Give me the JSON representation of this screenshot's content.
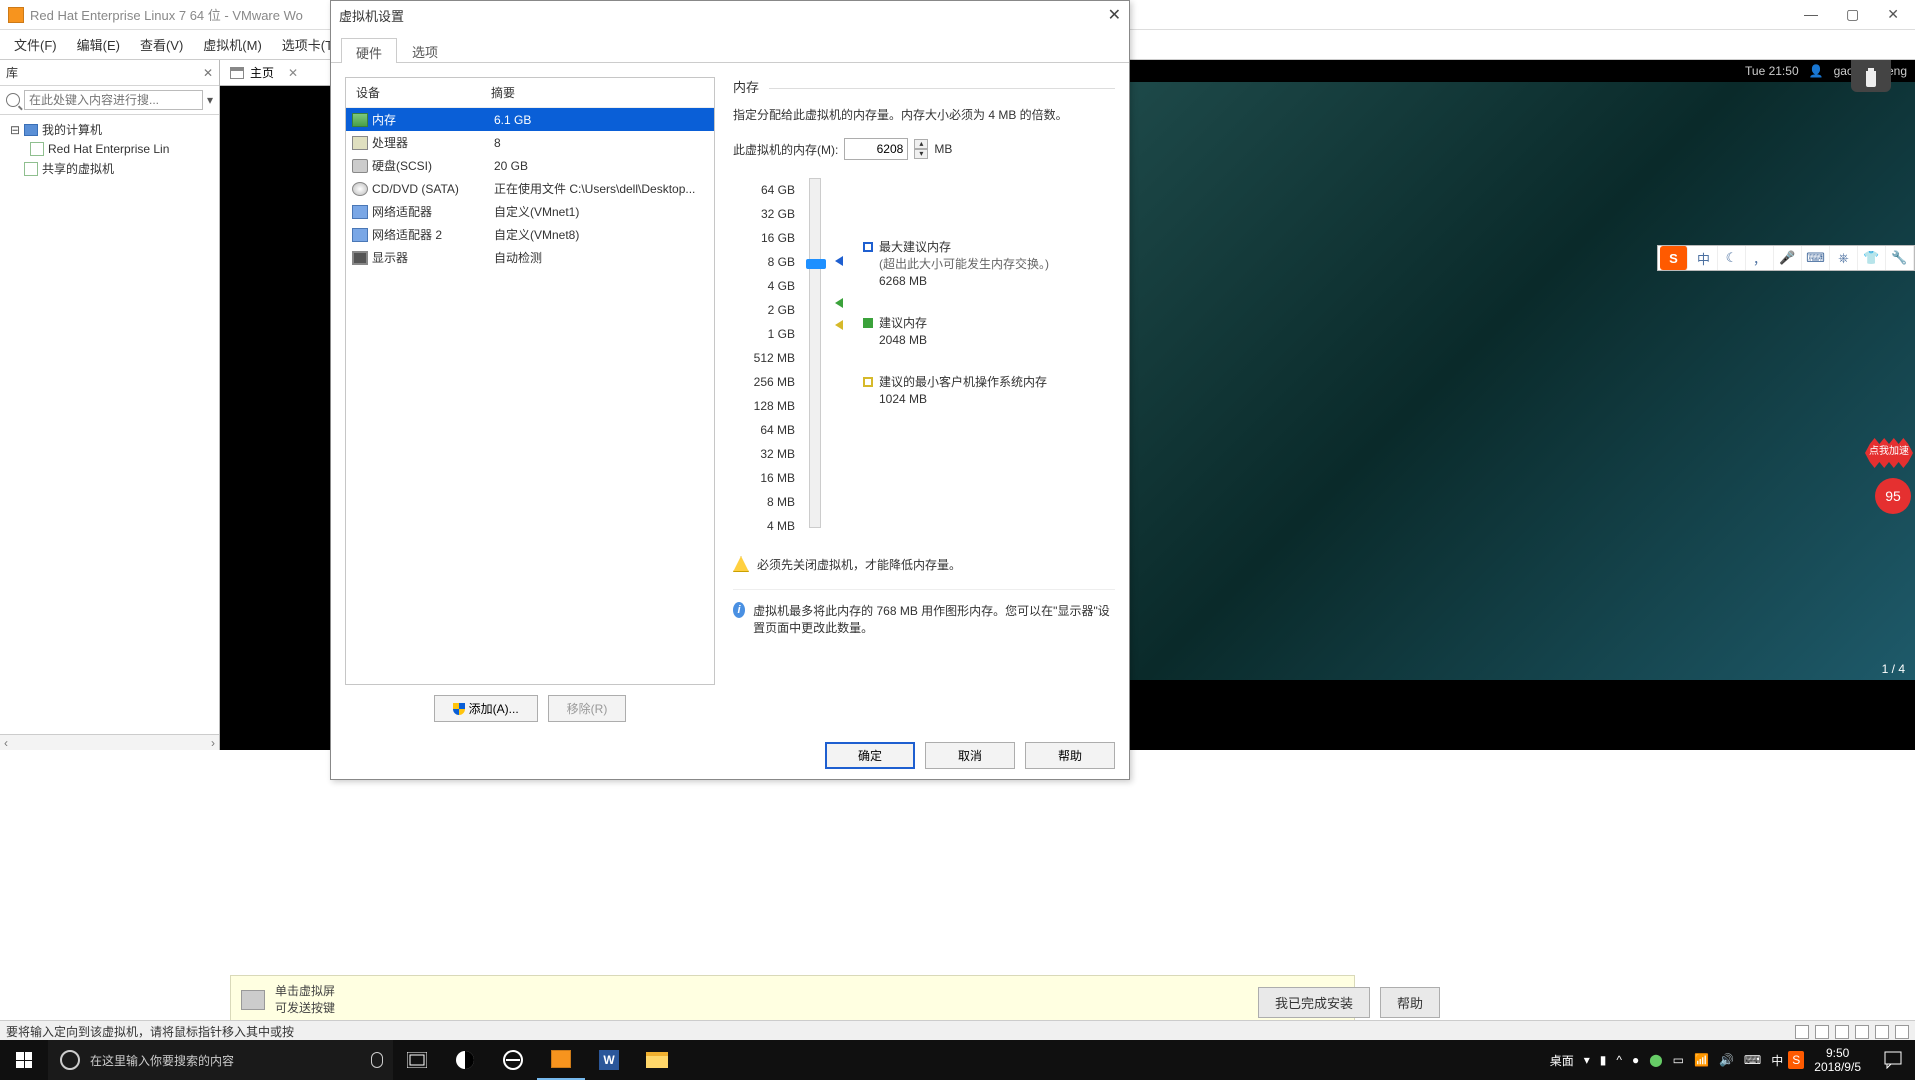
{
  "window": {
    "title": "Red Hat Enterprise Linux 7 64 位 - VMware Wo"
  },
  "menu": [
    "文件(F)",
    "编辑(E)",
    "查看(V)",
    "虚拟机(M)",
    "选项卡(T)"
  ],
  "library": {
    "title": "库",
    "search_placeholder": "在此处键入内容进行搜...",
    "tree": {
      "root": "我的计算机",
      "child": "Red Hat Enterprise Lin",
      "shared": "共享的虚拟机"
    }
  },
  "home_tab": "主页",
  "modal": {
    "title": "虚拟机设置",
    "tabs": [
      "硬件",
      "选项"
    ],
    "cols": [
      "设备",
      "摘要"
    ],
    "rows": [
      {
        "name": "内存",
        "summary": "6.1 GB",
        "icon": "mem",
        "sel": true
      },
      {
        "name": "处理器",
        "summary": "8",
        "icon": "cpu"
      },
      {
        "name": "硬盘(SCSI)",
        "summary": "20 GB",
        "icon": "hdd"
      },
      {
        "name": "CD/DVD (SATA)",
        "summary": "正在使用文件 C:\\Users\\dell\\Desktop...",
        "icon": "cd"
      },
      {
        "name": "网络适配器",
        "summary": "自定义(VMnet1)",
        "icon": "net"
      },
      {
        "name": "网络适配器 2",
        "summary": "自定义(VMnet8)",
        "icon": "net"
      },
      {
        "name": "显示器",
        "summary": "自动检测",
        "icon": "disp"
      }
    ],
    "add_btn": "添加(A)...",
    "remove_btn": "移除(R)",
    "group": "内存",
    "desc": "指定分配给此虚拟机的内存量。内存大小必须为 4 MB 的倍数。",
    "mem_label": "此虚拟机的内存(M):",
    "mem_value": "6208",
    "mem_unit": "MB",
    "ticks": [
      "64 GB",
      "32 GB",
      "16 GB",
      "8 GB",
      "4 GB",
      "2 GB",
      "1 GB",
      "512 MB",
      "256 MB",
      "128 MB",
      "64 MB",
      "32 MB",
      "16 MB",
      "8 MB",
      "4 MB"
    ],
    "legend_max": {
      "t": "最大建议内存",
      "sub": "(超出此大小可能发生内存交换。)",
      "v": "6268 MB"
    },
    "legend_rec": {
      "t": "建议内存",
      "v": "2048 MB"
    },
    "legend_min": {
      "t": "建议的最小客户机操作系统内存",
      "v": "1024 MB"
    },
    "warn": "必须先关闭虚拟机，才能降低内存量。",
    "info": "虚拟机最多将此内存的 768 MB 用作图形内存。您可以在\"显示器\"设置页面中更改此数量。",
    "ok": "确定",
    "cancel": "取消",
    "help": "帮助"
  },
  "tip": {
    "l1": "单击虚拟屏",
    "l2": "可发送按键"
  },
  "footer_btns": {
    "done": "我已完成安装",
    "help": "帮助"
  },
  "status": "要将输入定向到该虚拟机，请将鼠标指针移入其中或按",
  "vm": {
    "time": "Tue 21:50",
    "user": "gaonengneng",
    "page": "1 / 4"
  },
  "ime": {
    "char": "中"
  },
  "promo": {
    "t": "点我加速",
    "n": "95"
  },
  "taskbar": {
    "search": "在这里输入你要搜索的内容",
    "desktop": "桌面",
    "time": "9:50",
    "date": "2018/9/5",
    "ime": "中"
  }
}
